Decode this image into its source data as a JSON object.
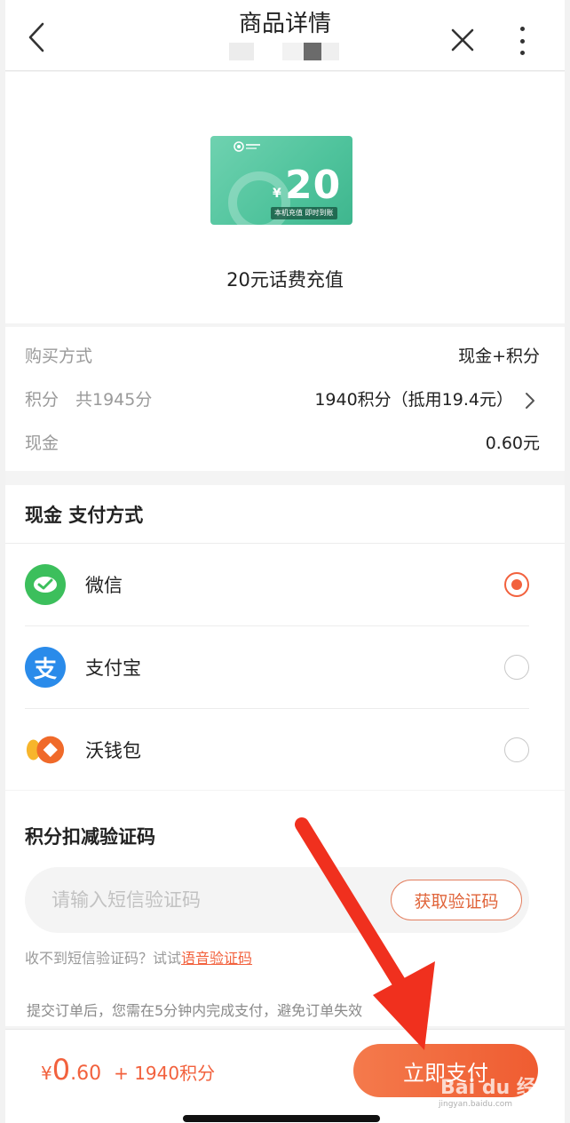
{
  "header": {
    "title": "商品详情"
  },
  "product": {
    "card_amount": "20",
    "card_yen": "¥",
    "card_tag": "本机充值 即时到账",
    "name": "20元话费充值"
  },
  "purchase": {
    "method_label": "购买方式",
    "method_value": "现金+积分",
    "points_label": "积分　共1945分",
    "points_value": "1940积分（抵用19.4元）",
    "cash_label": "现金",
    "cash_value": "0.60元"
  },
  "payment": {
    "title": "现金 支付方式",
    "options": [
      {
        "name": "微信",
        "icon": "wechat-icon",
        "selected": true,
        "color": "#3cbf5c"
      },
      {
        "name": "支付宝",
        "icon": "alipay-icon",
        "selected": false,
        "color": "#2a8bea"
      },
      {
        "name": "沃钱包",
        "icon": "wo-wallet-icon",
        "selected": false,
        "color": "#f2782a"
      }
    ]
  },
  "verify": {
    "title": "积分扣减验证码",
    "placeholder": "请输入短信验证码",
    "get_code_label": "获取验证码",
    "no_code_prefix": "收不到短信验证码？试试",
    "voice_link": "语音验证码",
    "notice": "提交订单后，您需在5分钟内完成支付，避免订单失效"
  },
  "bottom": {
    "yen": "¥",
    "price_int": "0",
    "price_dec": ".60",
    "points": "+ 1940积分",
    "pay_now_label": "立即支付"
  },
  "watermark": {
    "text": "Bai du 经验",
    "sub": "jingyan.baidu.com"
  },
  "colors": {
    "accent": "#f2613d",
    "wechat": "#3cbf5c",
    "alipay": "#2a8bea",
    "annotation_arrow": "#f0301e"
  }
}
